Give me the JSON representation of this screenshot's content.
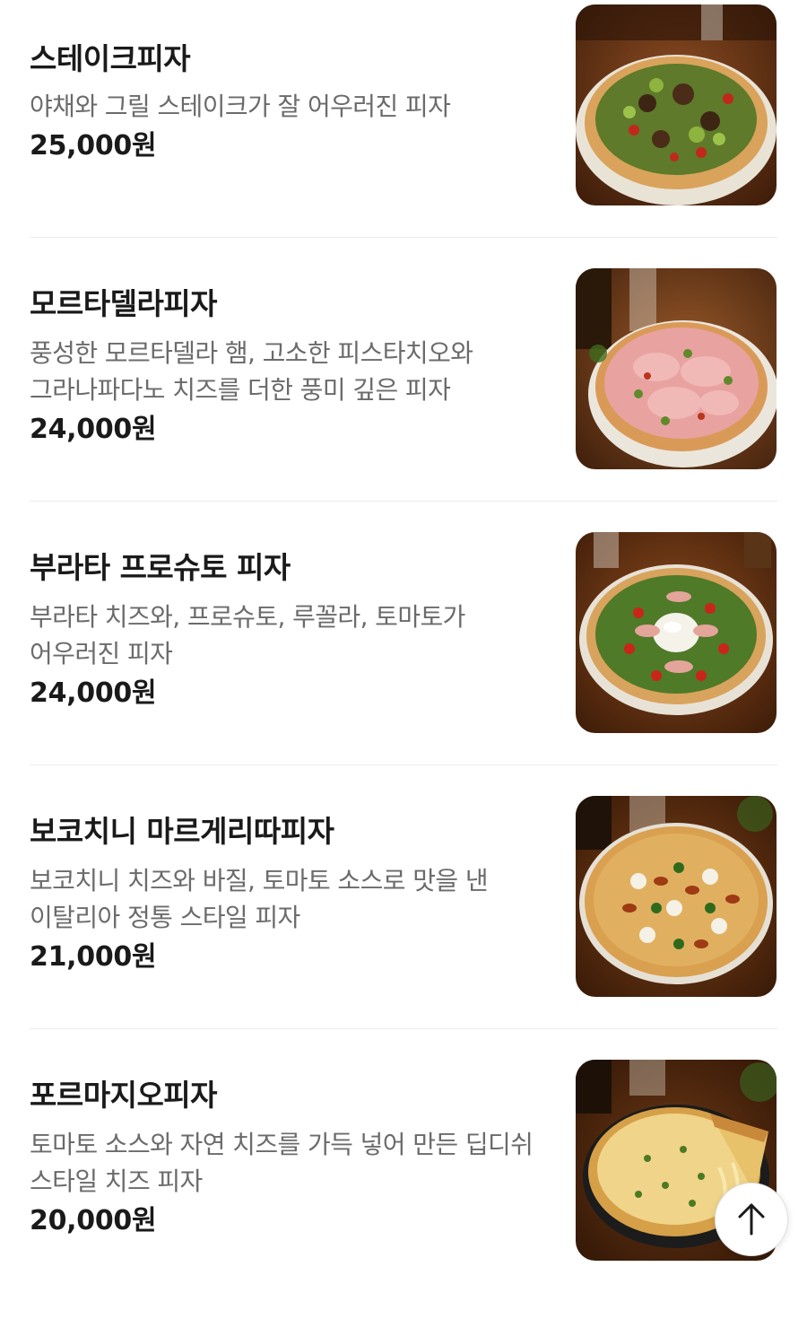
{
  "menu": {
    "items": [
      {
        "name": "스테이크피자",
        "description": "야채와 그릴 스테이크가 잘 어우러진 피자",
        "price": "25,000원",
        "image_icon": "steak-pizza-photo"
      },
      {
        "name": "모르타델라피자",
        "description": "풍성한 모르타델라 햄, 고소한 피스타치오와 그라나파다노 치즈를 더한 풍미 깊은 피자",
        "price": "24,000원",
        "image_icon": "mortadella-pizza-photo"
      },
      {
        "name": "부라타 프로슈토 피자",
        "description": "부라타 치즈와, 프로슈토, 루꼴라, 토마토가 어우러진 피자",
        "price": "24,000원",
        "image_icon": "burrata-prosciutto-pizza-photo"
      },
      {
        "name": "보코치니 마르게리따피자",
        "description": "보코치니 치즈와 바질, 토마토 소스로 맛을 낸 이탈리아 정통 스타일 피자",
        "price": "21,000원",
        "image_icon": "bocconcini-margherita-pizza-photo"
      },
      {
        "name": "포르마지오피자",
        "description": "토마토 소스와 자연 치즈를 가득 넣어 만든 딥디쉬 스타일 치즈 피자",
        "price": "20,000원",
        "image_icon": "formaggio-pizza-photo"
      }
    ]
  },
  "scroll_top_button": {
    "icon": "arrow-up-icon"
  },
  "colors": {
    "text_primary": "#1a1a1a",
    "text_secondary": "#6b6b6b",
    "divider": "#ececec",
    "background": "#ffffff"
  }
}
